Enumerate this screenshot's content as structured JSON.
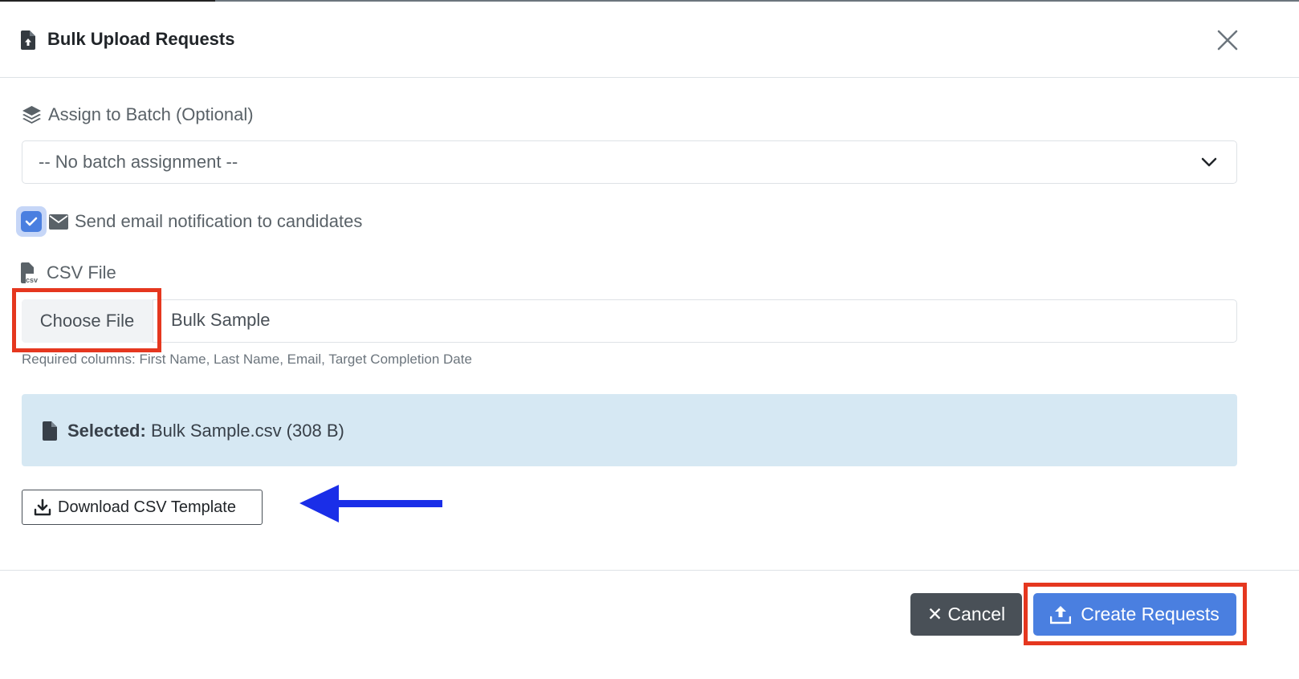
{
  "modal": {
    "title": "Bulk Upload Requests"
  },
  "batch": {
    "label": "Assign to Batch (Optional)",
    "selected": "-- No batch assignment --"
  },
  "email_notification": {
    "label": "Send email notification to candidates",
    "checked": true
  },
  "csv_file": {
    "label": "CSV File",
    "choose_button": "Choose File",
    "file_name": "Bulk Sample",
    "help": "Required columns: First Name, Last Name, Email, Target Completion Date"
  },
  "selected_alert": {
    "prefix": "Selected:",
    "value": "Bulk Sample.csv (308 B)"
  },
  "download_template": {
    "label": "Download CSV Template"
  },
  "footer": {
    "cancel_label": "✕ Cancel",
    "create_label": "Create Requests"
  },
  "colors": {
    "primary": "#4a7fe0",
    "secondary": "#495057",
    "highlight": "#e5371f",
    "arrow": "#1a2ee8",
    "alert_bg": "#d6e8f3"
  }
}
